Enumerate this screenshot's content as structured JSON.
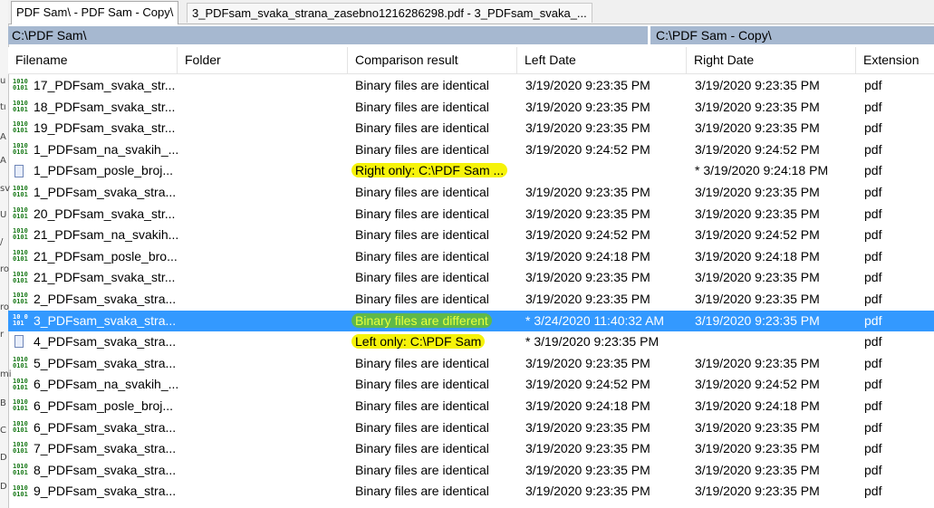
{
  "tabs": [
    {
      "label": "PDF Sam\\ - PDF Sam - Copy\\",
      "active": true
    },
    {
      "label": "3_PDFsam_svaka_strana_zasebno1216286298.pdf - 3_PDFsam_svaka_...",
      "active": false
    }
  ],
  "paths": {
    "left": "C:\\PDF Sam\\",
    "right": "C:\\PDF Sam - Copy\\"
  },
  "columns": [
    "Filename",
    "Folder",
    "Comparison result",
    "Left Date",
    "Right Date",
    "Extension"
  ],
  "background_chars": [
    "u",
    "tı",
    "A",
    "A",
    "sv",
    "U",
    "/",
    "ro",
    "ro",
    "r",
    "mi",
    "B",
    "C",
    "D",
    "D"
  ],
  "rows": [
    {
      "icon": "binary-icon",
      "name": "17_PDFsam_svaka_str...",
      "result": "Binary files are identical",
      "left": "3/19/2020 9:23:35 PM",
      "right": "3/19/2020 9:23:35 PM",
      "ext": "pdf"
    },
    {
      "icon": "binary-icon",
      "name": "18_PDFsam_svaka_str...",
      "result": "Binary files are identical",
      "left": "3/19/2020 9:23:35 PM",
      "right": "3/19/2020 9:23:35 PM",
      "ext": "pdf"
    },
    {
      "icon": "binary-icon",
      "name": "19_PDFsam_svaka_str...",
      "result": "Binary files are identical",
      "left": "3/19/2020 9:23:35 PM",
      "right": "3/19/2020 9:23:35 PM",
      "ext": "pdf"
    },
    {
      "icon": "binary-icon",
      "name": "1_PDFsam_na_svakih_...",
      "result": "Binary files are identical",
      "left": "3/19/2020 9:24:52 PM",
      "right": "3/19/2020 9:24:52 PM",
      "ext": "pdf"
    },
    {
      "icon": "right-only-file-icon",
      "name": "1_PDFsam_posle_broj...",
      "result": "Right only: C:\\PDF Sam ...",
      "left": "",
      "right": "* 3/19/2020 9:24:18 PM",
      "ext": "pdf",
      "highlight": "yellow"
    },
    {
      "icon": "binary-icon",
      "name": "1_PDFsam_svaka_stra...",
      "result": "Binary files are identical",
      "left": "3/19/2020 9:23:35 PM",
      "right": "3/19/2020 9:23:35 PM",
      "ext": "pdf"
    },
    {
      "icon": "binary-icon",
      "name": "20_PDFsam_svaka_str...",
      "result": "Binary files are identical",
      "left": "3/19/2020 9:23:35 PM",
      "right": "3/19/2020 9:23:35 PM",
      "ext": "pdf"
    },
    {
      "icon": "binary-icon",
      "name": "21_PDFsam_na_svakih...",
      "result": "Binary files are identical",
      "left": "3/19/2020 9:24:52 PM",
      "right": "3/19/2020 9:24:52 PM",
      "ext": "pdf"
    },
    {
      "icon": "binary-icon",
      "name": "21_PDFsam_posle_bro...",
      "result": "Binary files are identical",
      "left": "3/19/2020 9:24:18 PM",
      "right": "3/19/2020 9:24:18 PM",
      "ext": "pdf"
    },
    {
      "icon": "binary-icon",
      "name": "21_PDFsam_svaka_str...",
      "result": "Binary files are identical",
      "left": "3/19/2020 9:23:35 PM",
      "right": "3/19/2020 9:23:35 PM",
      "ext": "pdf"
    },
    {
      "icon": "binary-icon",
      "name": "2_PDFsam_svaka_stra...",
      "result": "Binary files are identical",
      "left": "3/19/2020 9:23:35 PM",
      "right": "3/19/2020 9:23:35 PM",
      "ext": "pdf"
    },
    {
      "icon": "binary-diff-icon",
      "name": "3_PDFsam_svaka_stra...",
      "result": "Binary files are different",
      "left": "* 3/24/2020 11:40:32 AM",
      "right": "3/19/2020 9:23:35 PM",
      "ext": "pdf",
      "highlight": "green",
      "selected": true
    },
    {
      "icon": "left-only-file-icon",
      "name": "4_PDFsam_svaka_stra...",
      "result": "Left only: C:\\PDF Sam",
      "left": "* 3/19/2020 9:23:35 PM",
      "right": "",
      "ext": "pdf",
      "highlight": "yellow"
    },
    {
      "icon": "binary-icon",
      "name": "5_PDFsam_svaka_stra...",
      "result": "Binary files are identical",
      "left": "3/19/2020 9:23:35 PM",
      "right": "3/19/2020 9:23:35 PM",
      "ext": "pdf"
    },
    {
      "icon": "binary-icon",
      "name": "6_PDFsam_na_svakih_...",
      "result": "Binary files are identical",
      "left": "3/19/2020 9:24:52 PM",
      "right": "3/19/2020 9:24:52 PM",
      "ext": "pdf"
    },
    {
      "icon": "binary-icon",
      "name": "6_PDFsam_posle_broj...",
      "result": "Binary files are identical",
      "left": "3/19/2020 9:24:18 PM",
      "right": "3/19/2020 9:24:18 PM",
      "ext": "pdf"
    },
    {
      "icon": "binary-icon",
      "name": "6_PDFsam_svaka_stra...",
      "result": "Binary files are identical",
      "left": "3/19/2020 9:23:35 PM",
      "right": "3/19/2020 9:23:35 PM",
      "ext": "pdf"
    },
    {
      "icon": "binary-icon",
      "name": "7_PDFsam_svaka_stra...",
      "result": "Binary files are identical",
      "left": "3/19/2020 9:23:35 PM",
      "right": "3/19/2020 9:23:35 PM",
      "ext": "pdf"
    },
    {
      "icon": "binary-icon",
      "name": "8_PDFsam_svaka_stra...",
      "result": "Binary files are identical",
      "left": "3/19/2020 9:23:35 PM",
      "right": "3/19/2020 9:23:35 PM",
      "ext": "pdf"
    },
    {
      "icon": "binary-icon",
      "name": "9_PDFsam_svaka_stra...",
      "result": "Binary files are identical",
      "left": "3/19/2020 9:23:35 PM",
      "right": "3/19/2020 9:23:35 PM",
      "ext": "pdf"
    }
  ]
}
